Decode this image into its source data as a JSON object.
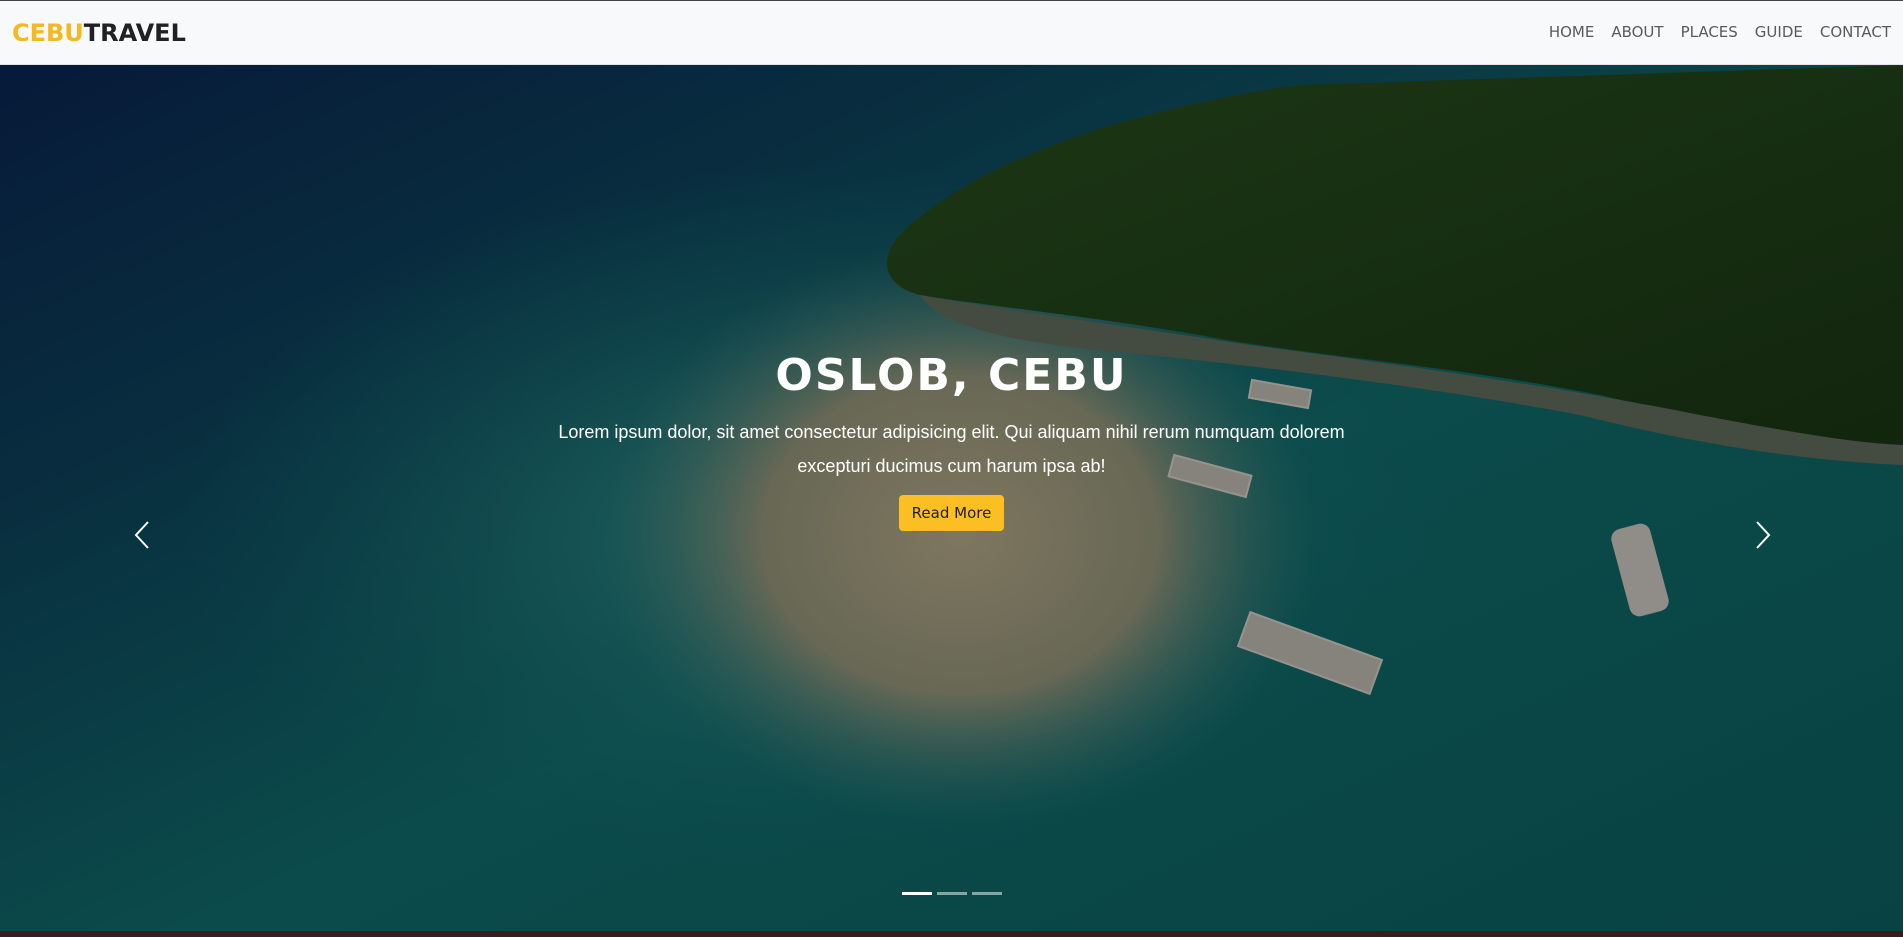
{
  "navbar": {
    "brand_part1": "CEBU",
    "brand_part2": "TRAVEL",
    "links": [
      {
        "label": "HOME"
      },
      {
        "label": "ABOUT"
      },
      {
        "label": "PLACES"
      },
      {
        "label": "GUIDE"
      },
      {
        "label": "CONTACT"
      }
    ]
  },
  "hero": {
    "title": "OSLOB, CEBU",
    "description": "Lorem ipsum dolor, sit amet consectetur adipisicing elit. Qui aliquam nihil rerum numquam dolorem excepturi ducimus cum harum ipsa ab!",
    "button_label": "Read More",
    "slides_count": 3,
    "active_slide": 1
  },
  "colors": {
    "brand_accent": "#f4b921",
    "button": "#fbbf24",
    "navbar_bg": "#f8f9fa"
  },
  "icons": {
    "prev": "chevron-left-icon",
    "next": "chevron-right-icon"
  }
}
